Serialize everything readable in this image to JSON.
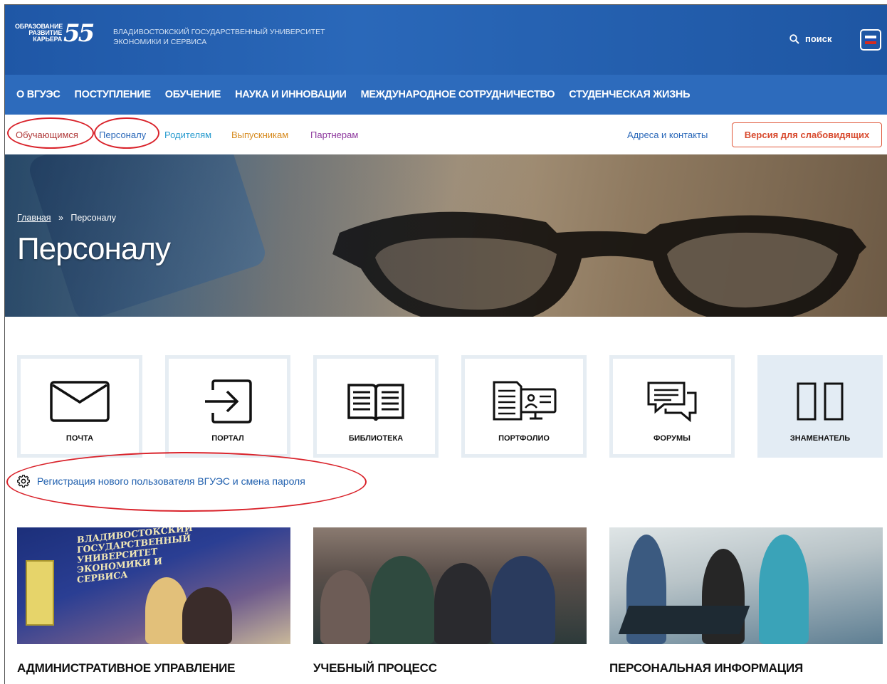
{
  "header": {
    "logo_lines": [
      "ОБРАЗОВАНИЕ",
      "РАЗВИТИЕ",
      "КАРЬЕРА"
    ],
    "logo_number": "55",
    "university_name": "ВЛАДИВОСТОКСКИЙ ГОСУДАРСТВЕННЫЙ УНИВЕРСИТЕТ ЭКОНОМИКИ И СЕРВИСА",
    "search_label": "поиск",
    "search_icon": "search-icon",
    "language_icon": "russian-flag-icon"
  },
  "main_nav": [
    "О ВГУЭС",
    "ПОСТУПЛЕНИЕ",
    "ОБУЧЕНИЕ",
    "НАУКА И ИННОВАЦИИ",
    "МЕЖДУНАРОДНОЕ СОТРУДНИЧЕСТВО",
    "СТУДЕНЧЕСКАЯ ЖИЗНЬ"
  ],
  "audience_nav": {
    "students": "Обучающимся",
    "staff": "Персоналу",
    "parents": "Родителям",
    "graduates": "Выпускникам",
    "partners": "Партнерам",
    "contacts": "Адреса и контакты",
    "visually_impaired": "Версия для слабовидящих"
  },
  "hero": {
    "breadcrumb_home": "Главная",
    "breadcrumb_sep": "»",
    "breadcrumb_current": "Персоналу",
    "title": "Персоналу"
  },
  "services": [
    {
      "label": "почта",
      "icon": "mail-icon"
    },
    {
      "label": "портал",
      "icon": "login-icon"
    },
    {
      "label": "библиотека",
      "icon": "book-icon"
    },
    {
      "label": "портфолио",
      "icon": "portfolio-icon"
    },
    {
      "label": "форумы",
      "icon": "forum-icon"
    },
    {
      "label": "знаменатель",
      "icon": "znamenatel-icon"
    }
  ],
  "registration_link": "Регистрация нового пользователя ВГУЭС и смена пароля",
  "cards": [
    {
      "title": "АДМИНИСТРАТИВНОЕ УПРАВЛЕНИЕ",
      "banner": "ВЛАДИВОСТОКСКИЙ ГОСУДАРСТВЕННЫЙ УНИВЕРСИТЕТ ЭКОНОМИКИ и СЕРВИСА"
    },
    {
      "title": "УЧЕБНЫЙ ПРОЦЕСС"
    },
    {
      "title": "ПЕРСОНАЛЬНАЯ ИНФОРМАЦИЯ"
    }
  ],
  "colors": {
    "header_blue": "#1f57a6",
    "nav_blue": "#2d6bbc",
    "link_blue": "#1f5fae",
    "annotation_red": "#d9222a",
    "vi_button_orange": "#e0573a"
  }
}
